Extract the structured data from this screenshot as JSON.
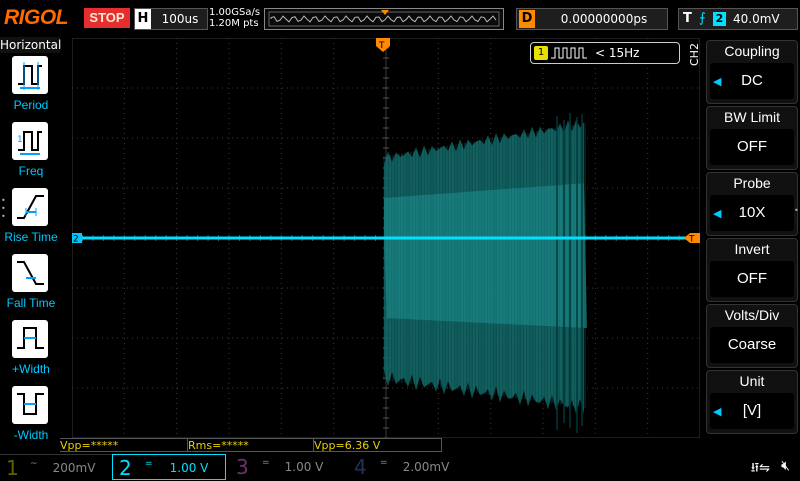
{
  "brand": "RIGOL",
  "run_state": "STOP",
  "horizontal": {
    "label": "H",
    "timebase": "100us",
    "sample_rate": "1.00GSa/s",
    "mem_depth": "1.20M pts"
  },
  "delay": {
    "label": "D",
    "value": "0.00000000ps"
  },
  "trigger": {
    "label": "T",
    "source": "2",
    "level": "40.0mV",
    "marker": "T"
  },
  "left_menu": {
    "title": "Horizontal",
    "items": [
      {
        "label": "Period",
        "icon": "period-icon"
      },
      {
        "label": "Freq",
        "icon": "frequency-icon"
      },
      {
        "label": "Rise Time",
        "icon": "rise-time-icon"
      },
      {
        "label": "Fall Time",
        "icon": "fall-time-icon"
      },
      {
        "label": "+Width",
        "icon": "positive-width-icon"
      },
      {
        "label": "-Width",
        "icon": "negative-width-icon"
      }
    ]
  },
  "screen": {
    "counter_badge": "1",
    "counter_value": "< 15Hz",
    "channel_marker": "2",
    "trigger_level_marker": "T"
  },
  "right_menu": {
    "channel_tab": "CH2",
    "items": [
      {
        "title": "Coupling",
        "value": "DC",
        "arrow": true
      },
      {
        "title": "BW Limit",
        "value": "OFF",
        "arrow": false
      },
      {
        "title": "Probe",
        "value": "10X",
        "arrow": true
      },
      {
        "title": "Invert",
        "value": "OFF",
        "arrow": false
      },
      {
        "title": "Volts/Div",
        "value": "Coarse",
        "arrow": false
      },
      {
        "title": "Unit",
        "value": "[V]",
        "arrow": true
      }
    ]
  },
  "measurements": [
    {
      "text": "Vpp=*****"
    },
    {
      "text": "Rms=*****"
    },
    {
      "text": "Vpp=6.36 V"
    }
  ],
  "channels": [
    {
      "num": "1",
      "coupling": "~",
      "scale": "200mV",
      "color": "#606000",
      "active": false
    },
    {
      "num": "2",
      "coupling": "=",
      "scale": "1.00 V",
      "color": "#00e0ff",
      "active": true
    },
    {
      "num": "3",
      "coupling": "=",
      "scale": "1.00 V",
      "color": "#703070",
      "active": false
    },
    {
      "num": "4",
      "coupling": "=",
      "scale": "2.00mV",
      "color": "#203060",
      "active": false
    }
  ],
  "status_icons": {
    "usb": "usb-icon",
    "speaker": "speaker-muted-icon"
  },
  "colors": {
    "ch2": "#00e0ff",
    "trigger": "#ff8a00",
    "grid": "#3a3a3a",
    "stop": "#e52e2e"
  }
}
